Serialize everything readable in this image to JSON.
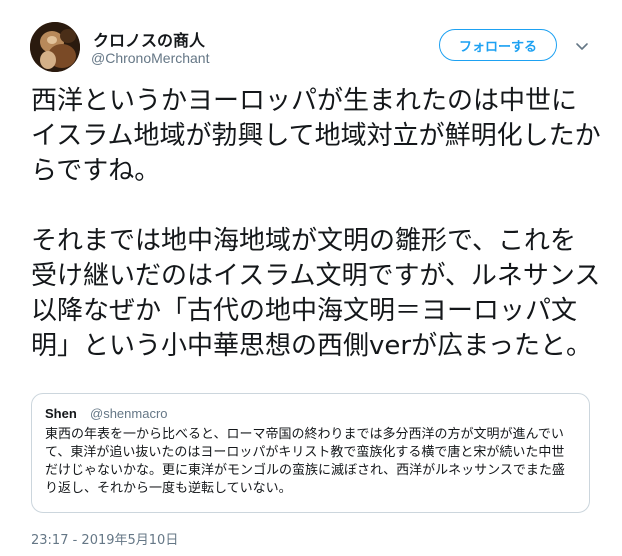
{
  "author": {
    "display_name": "クロノスの商人",
    "handle": "@ChronoMerchant"
  },
  "follow_button": {
    "label": "フォローする"
  },
  "tweet": {
    "paragraphs": [
      "西洋というかヨーロッパが生まれたのは中世にイスラム地域が勃興して地域対立が鮮明化したからですね。",
      "それまでは地中海地域が文明の雛形で、これを受け継いだのはイスラム文明ですが、ルネサンス以降なぜか「古代の地中海文明＝ヨーロッパ文明」という小中華思想の西側verが広まったと。"
    ]
  },
  "quote": {
    "author_name": "Shen",
    "author_handle": "@shenmacro",
    "text": "東西の年表を一から比べると、ローマ帝国の終わりまでは多分西洋の方が文明が進んでいて、東洋が追い抜いたのはヨーロッパがキリスト教で蛮族化する横で唐と宋が続いた中世だけじゃないかな。更に東洋がモンゴルの蛮族に滅ぼされ、西洋がルネッサンスでまた盛り返し、それから一度も逆転していない。"
  },
  "timestamp": "23:17 - 2019年5月10日",
  "colors": {
    "accent": "#1da1f2",
    "text": "#14171a",
    "secondary": "#657786",
    "border": "#ccd6dd"
  },
  "icons": {
    "avatar": "avatar-image",
    "menu": "chevron-down-icon"
  }
}
